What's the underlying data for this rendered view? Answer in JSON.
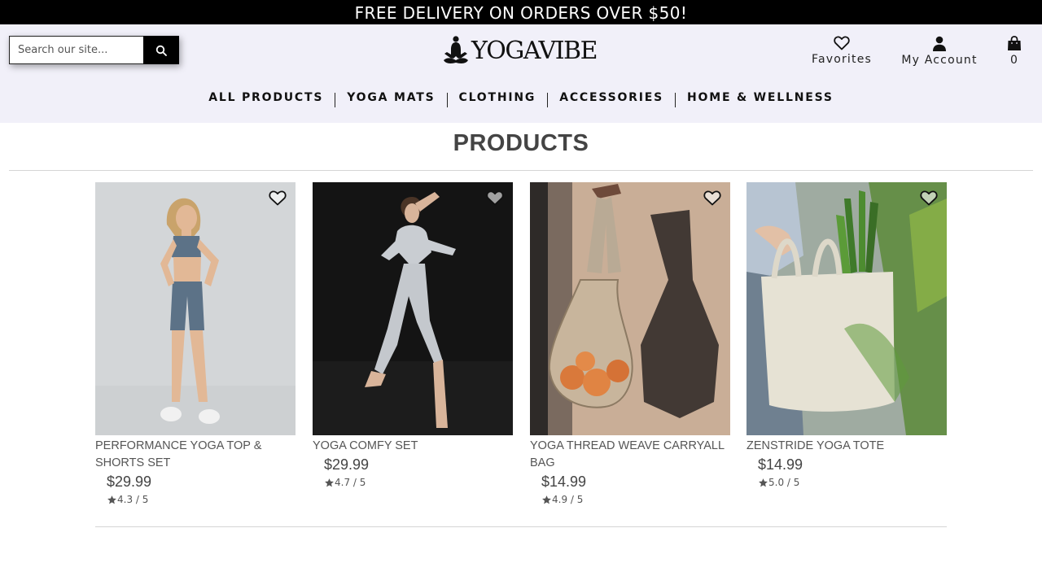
{
  "promo": {
    "text": "FREE DELIVERY ON ORDERS OVER $50!"
  },
  "search": {
    "placeholder": "Search our site..."
  },
  "logo": {
    "text": "YOGAVIBE"
  },
  "header_actions": {
    "favorites_label": "Favorites",
    "account_label": "My Account",
    "cart_count": "0"
  },
  "nav": {
    "items": [
      {
        "label": "ALL PRODUCTS"
      },
      {
        "label": "YOGA MATS"
      },
      {
        "label": "CLOTHING"
      },
      {
        "label": "ACCESSORIES"
      },
      {
        "label": "HOME & WELLNESS"
      }
    ]
  },
  "page": {
    "title": "PRODUCTS"
  },
  "products": [
    {
      "name": "PERFORMANCE YOGA TOP & SHORTS SET",
      "price": "$29.99",
      "rating": "4.3 / 5"
    },
    {
      "name": "YOGA COMFY SET",
      "price": "$29.99",
      "rating": "4.7 / 5"
    },
    {
      "name": "YOGA THREAD WEAVE CARRYALL BAG",
      "price": "$14.99",
      "rating": "4.9 / 5"
    },
    {
      "name": "ZENSTRIDE YOGA TOTE",
      "price": "$14.99",
      "rating": "5.0 / 5"
    }
  ],
  "icons": {
    "search": "search-icon",
    "favorites": "heart-icon",
    "account": "user-icon",
    "cart": "shopping-bag-icon",
    "rating": "star-icon",
    "logo": "meditation-figure-icon"
  },
  "colors": {
    "promo_bg": "#000000",
    "header_bg": "#f1f0f9",
    "text": "#222222"
  }
}
